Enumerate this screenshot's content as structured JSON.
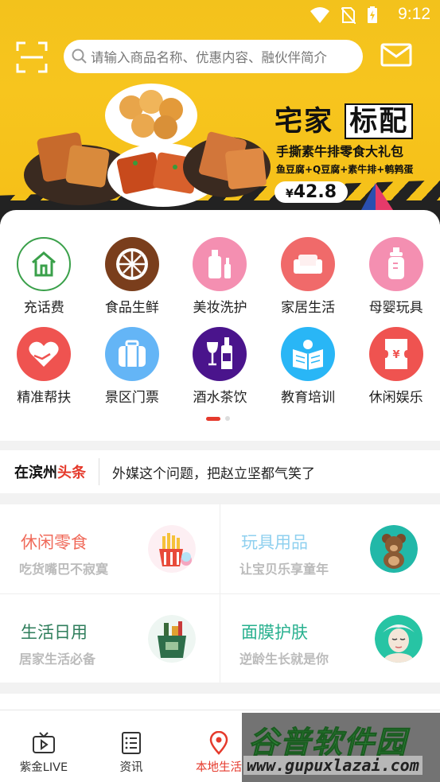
{
  "status_bar": {
    "time": "9:12"
  },
  "search": {
    "placeholder": "请输入商品名称、优惠内容、融伙伴简介"
  },
  "banner": {
    "title_a": "宅家",
    "title_b": "标配",
    "subtitle": "手撕素牛排零食大礼包",
    "detail": "鱼豆腐+Q豆腐+素牛排+鹌鹑蛋",
    "price_currency": "¥",
    "price": "42.8"
  },
  "categories": [
    {
      "label": "充话费",
      "icon": "house-icon",
      "color": "#ffffff"
    },
    {
      "label": "食品生鲜",
      "icon": "orange-icon",
      "color": "#7a3e1c"
    },
    {
      "label": "美妆洗护",
      "icon": "cosmetics-icon",
      "color": "#f48fb1"
    },
    {
      "label": "家居生活",
      "icon": "sofa-icon",
      "color": "#f06a6a"
    },
    {
      "label": "母婴玩具",
      "icon": "baby-bottle-icon",
      "color": "#f48fb1"
    },
    {
      "label": "精准帮扶",
      "icon": "heart-hands-icon",
      "color": "#ef5350"
    },
    {
      "label": "景区门票",
      "icon": "luggage-icon",
      "color": "#64b5f6"
    },
    {
      "label": "酒水茶饮",
      "icon": "wine-icon",
      "color": "#4a148c"
    },
    {
      "label": "教育培训",
      "icon": "book-icon",
      "color": "#29b6f6"
    },
    {
      "label": "休闲娱乐",
      "icon": "ticket-icon",
      "color": "#ef5350"
    }
  ],
  "news": {
    "brand_a": "在滨州",
    "brand_b": "头条",
    "headline": "外媒这个问题，把赵立坚都气笑了"
  },
  "cards": [
    {
      "title": "休闲零食",
      "subtitle": "吃货嘴巴不寂寞",
      "title_color": "#f06a5a",
      "icon": "fries-icon"
    },
    {
      "title": "玩具用品",
      "subtitle": "让宝贝乐享童年",
      "title_color": "#8fd0ef",
      "icon": "teddy-bear-icon"
    },
    {
      "title": "生活日用",
      "subtitle": "居家生活必备",
      "title_color": "#2e7d5b",
      "icon": "grocery-bag-icon"
    },
    {
      "title": "面膜护肤",
      "subtitle": "逆龄生长就是你",
      "title_color": "#27b08e",
      "icon": "face-mask-icon"
    }
  ],
  "bottom_nav": [
    {
      "label": "紫金LIVE",
      "icon": "tv-icon",
      "active": false
    },
    {
      "label": "资讯",
      "icon": "list-icon",
      "active": false
    },
    {
      "label": "本地生活",
      "icon": "location-pin-icon",
      "active": true
    }
  ],
  "watermark": {
    "title": "谷普软件园",
    "url": "www.gupuxlazai.com"
  }
}
